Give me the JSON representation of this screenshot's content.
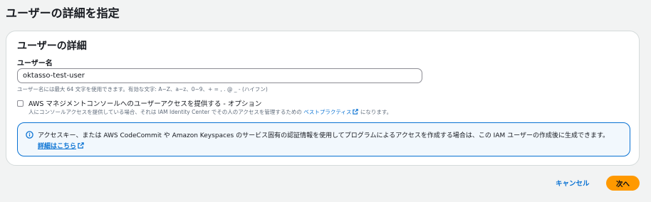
{
  "page": {
    "title": "ユーザーの詳細を指定"
  },
  "user_details": {
    "section_title": "ユーザーの詳細",
    "username_label": "ユーザー名",
    "username_value": "oktasso-test-user",
    "username_hint": "ユーザー名には最大 64 文字を使用できます。有効な文字: A~Z、a~z、0~9、+ = , . @ _ - (ハイフン)",
    "console_access": {
      "checked": false,
      "label": "AWS マネジメントコンソールへのユーザーアクセスを提供する - オプション",
      "desc_prefix": "人にコンソールアクセスを提供している場合、それは IAM Identity Center でその人のアクセスを管理するための ",
      "desc_link": "ベストプラクティス",
      "desc_suffix": " になります。"
    },
    "info_alert": {
      "text": "アクセスキー、または AWS CodeCommit や Amazon Keyspaces のサービス固有の認証情報を使用してプログラムによるアクセスを作成する場合は、この IAM ユーザーの作成後に生成できます。",
      "link": "詳細はこちら"
    }
  },
  "actions": {
    "cancel_label": "キャンセル",
    "next_label": "次へ"
  },
  "icons": {
    "info": "info-icon",
    "external_link": "external-link-icon"
  },
  "colors": {
    "link": "#0972d3",
    "primary_button": "#ff9900",
    "alert_border": "#0972d3",
    "alert_background": "#f2f8fd"
  }
}
